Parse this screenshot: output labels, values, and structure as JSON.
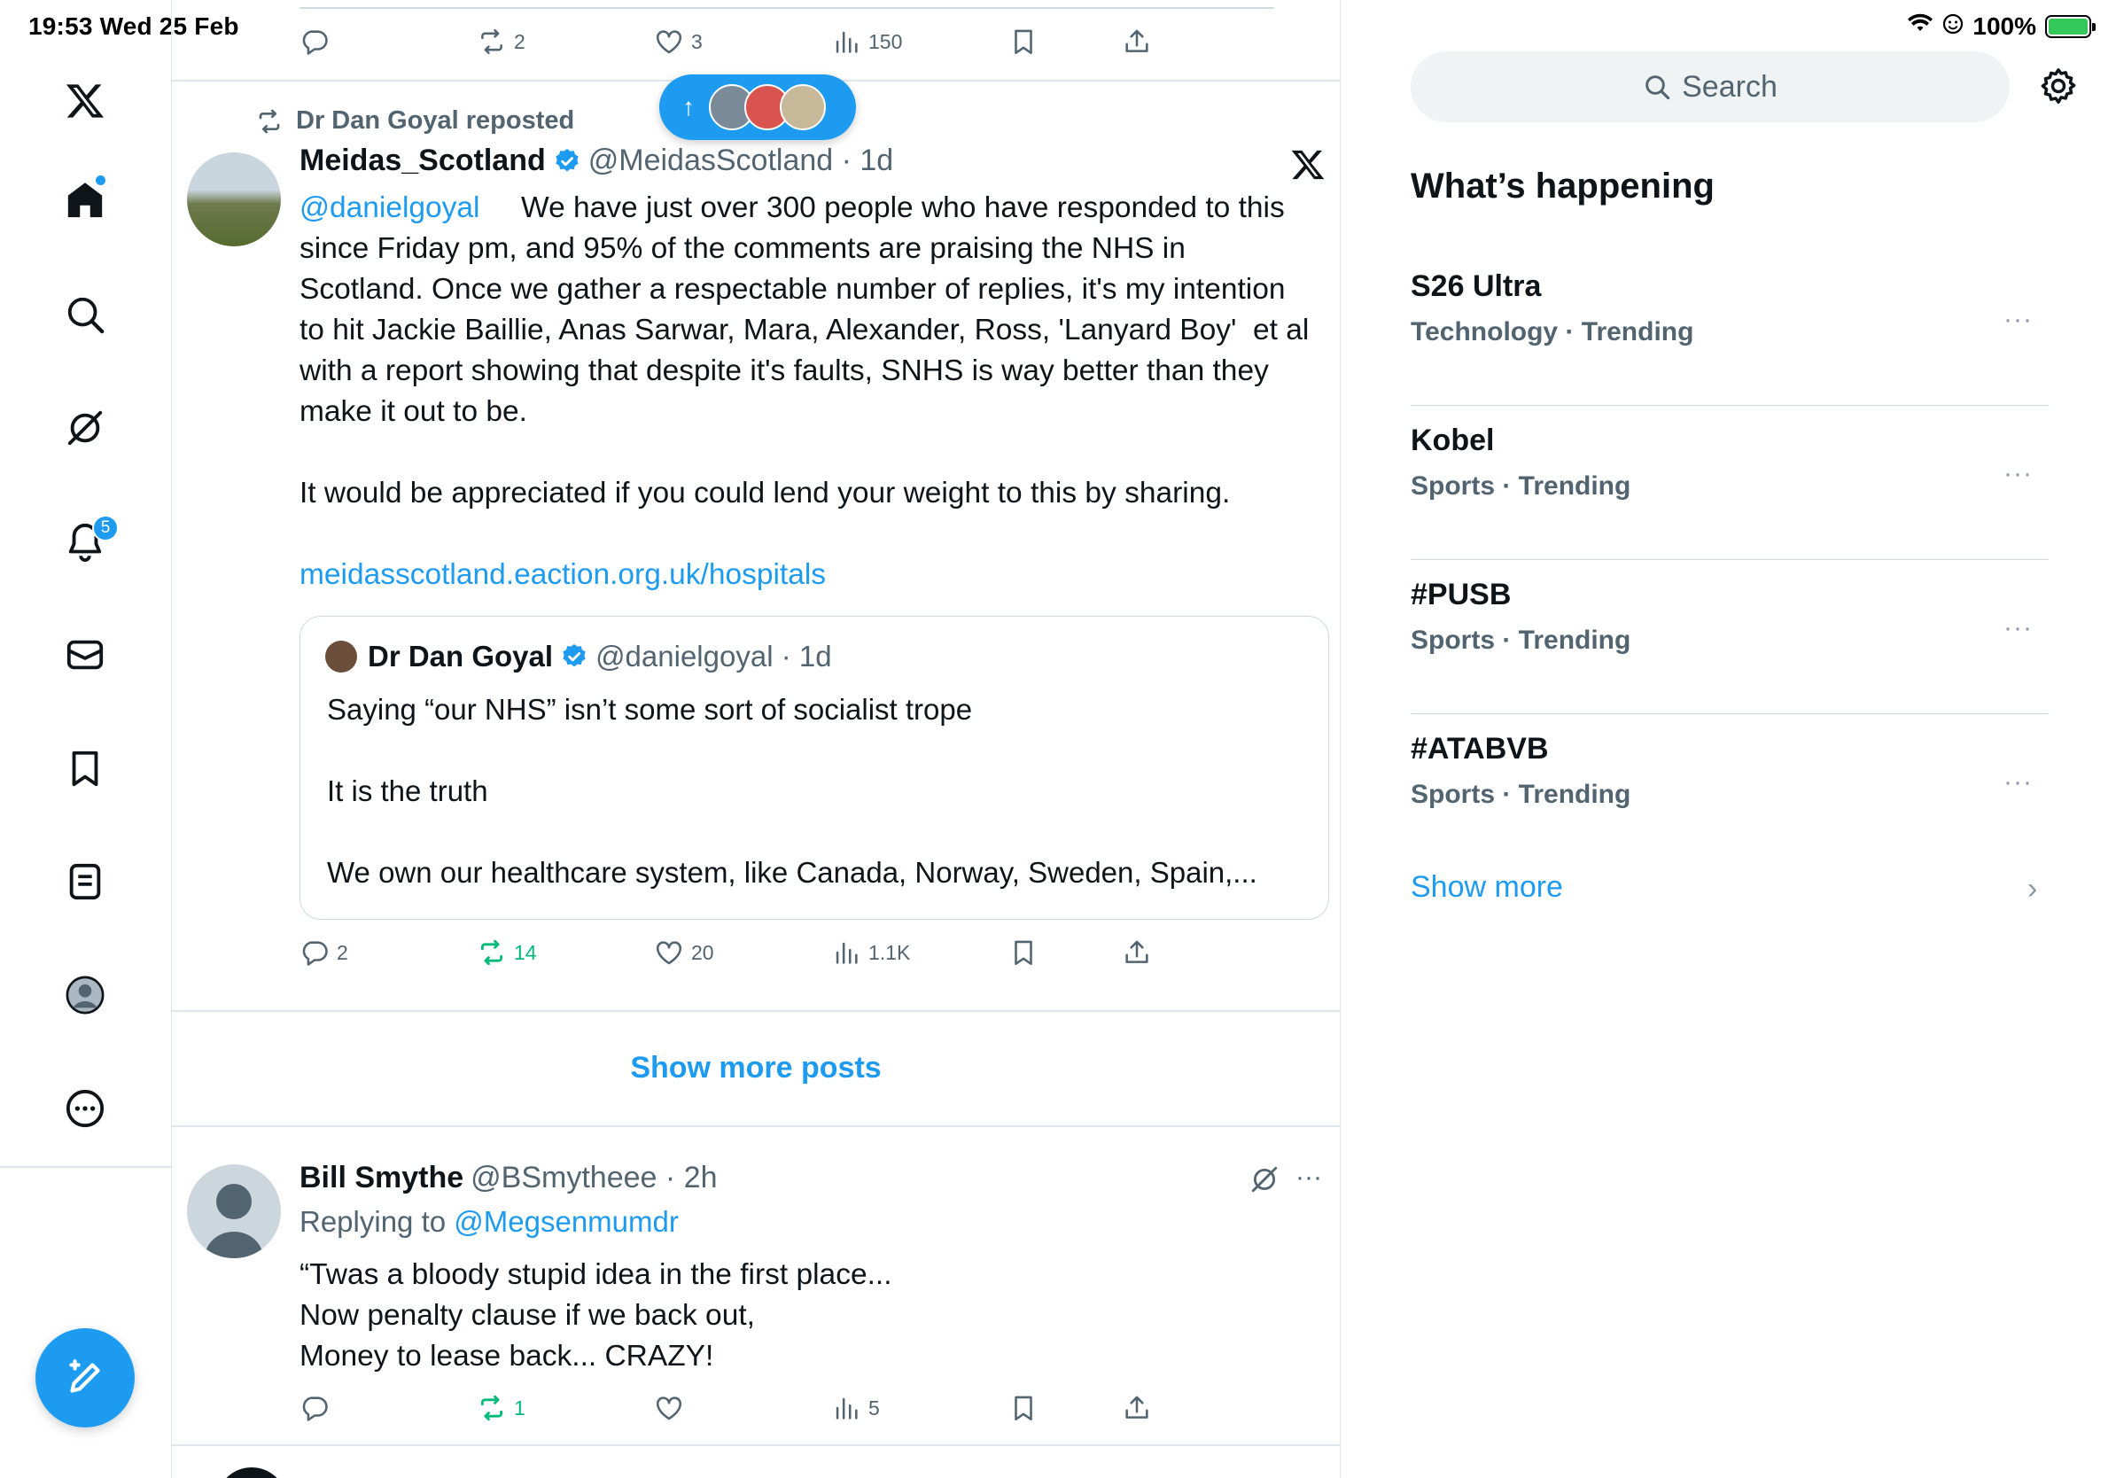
{
  "status": {
    "time_date": "19:53   Wed 25 Feb",
    "battery": "100%"
  },
  "nav": {
    "notification_count": "5"
  },
  "top_tweet": {
    "reply_count": "",
    "repost_count": "2",
    "like_count": "3",
    "view_count": "150"
  },
  "pill": {
    "arrow": "↑"
  },
  "repost_tweet": {
    "reposted_by": "Dr Dan Goyal reposted",
    "name": "Meidas_Scotland",
    "handle_time": "@MeidasScotland · 1d",
    "mention": "@danielgoyal",
    "text": "     We have just over 300 people who have responded to this since Friday pm, and 95% of the comments are praising the NHS in Scotland. Once we gather a respectable number of replies, it's my intention to hit Jackie Baillie, Anas Sarwar, Mara, Alexander, Ross, 'Lanyard Boy'  et al with a report showing that despite it's faults, SNHS is way better than they make it out to be.\n\nIt would be appreciated if you could lend your weight to this by sharing.\n\n",
    "link": "meidasscotland.eaction.org.uk/hospitals",
    "reply_count": "2",
    "repost_count": "14",
    "like_count": "20",
    "view_count": "1.1K",
    "quote": {
      "name": "Dr Dan Goyal",
      "handle_time": "@danielgoyal · 1d",
      "text": "Saying “our NHS” isn’t some sort of socialist trope\n\nIt is the truth\n\nWe own our healthcare system, like Canada, Norway, Sweden, Spain,..."
    }
  },
  "show_more_posts": "Show more posts",
  "reply_tweet": {
    "name": "Bill Smythe",
    "handle_time": "@BSmytheee · 2h",
    "replying_prefix": "Replying to ",
    "replying_handle": "@Megsenmumdr",
    "text": "“Twas a bloody stupid idea in the first place...\nNow penalty clause if we back out,\nMoney to lease back... CRAZY!",
    "reply_count": "",
    "repost_count": "1",
    "like_count": "",
    "view_count": "5",
    "more": "···"
  },
  "sidebar": {
    "search_placeholder": "Search",
    "title": "What’s happening",
    "trends": [
      {
        "name": "S26 Ultra",
        "meta": "Technology · Trending",
        "more": "···"
      },
      {
        "name": "Kobel",
        "meta": "Sports · Trending",
        "more": "···"
      },
      {
        "name": "#PUSB",
        "meta": "Sports · Trending",
        "more": "···"
      },
      {
        "name": "#ATABVB",
        "meta": "Sports · Trending",
        "more": "···"
      }
    ],
    "show_more": "Show more",
    "chevron": "›"
  },
  "colors": {
    "accent": "#1d9bf0",
    "repost_green": "#00ba7c",
    "secondary_text": "#536471"
  }
}
